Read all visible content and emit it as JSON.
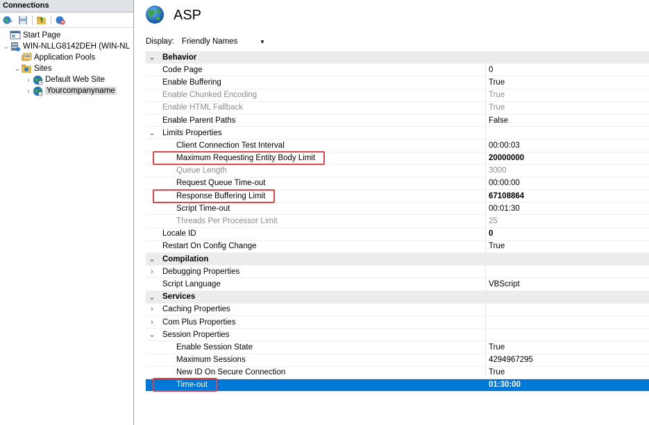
{
  "connections": {
    "header": "Connections",
    "toolbar": [
      {
        "icon": "connect-globe-icon"
      },
      {
        "icon": "save-icon"
      },
      {
        "icon": "up-folder-icon"
      },
      {
        "icon": "disconnect-icon"
      }
    ],
    "tree": [
      {
        "label": "Start Page",
        "icon": "start-page-icon",
        "level": 0,
        "expander": ""
      },
      {
        "label": "WIN-NLLG8142DEH (WIN-NL",
        "icon": "server-icon",
        "level": 0,
        "expander": "⌄"
      },
      {
        "label": "Application Pools",
        "icon": "app-pools-icon",
        "level": 1,
        "expander": ""
      },
      {
        "label": "Sites",
        "icon": "sites-folder-icon",
        "level": 1,
        "expander": "⌄"
      },
      {
        "label": "Default Web Site",
        "icon": "globe-icon",
        "level": 2,
        "expander": "›"
      },
      {
        "label": "Yourcompanyname",
        "icon": "globe-icon",
        "level": 2,
        "expander": "›",
        "selected": true
      }
    ]
  },
  "page": {
    "title": "ASP",
    "display_label": "Display:",
    "display_value": "Friendly Names"
  },
  "properties": [
    {
      "type": "category",
      "toggle": "⌄",
      "name": "Behavior",
      "value": ""
    },
    {
      "type": "prop",
      "level": 1,
      "name": "Code Page",
      "value": "0"
    },
    {
      "type": "prop",
      "level": 1,
      "name": "Enable Buffering",
      "value": "True"
    },
    {
      "type": "prop",
      "level": 1,
      "name": "Enable Chunked Encoding",
      "value": "True",
      "disabled": true
    },
    {
      "type": "prop",
      "level": 1,
      "name": "Enable HTML Fallback",
      "value": "True",
      "disabled": true
    },
    {
      "type": "prop",
      "level": 1,
      "name": "Enable Parent Paths",
      "value": "False"
    },
    {
      "type": "group",
      "toggle": "⌄",
      "level": 1,
      "name": "Limits Properties",
      "value": ""
    },
    {
      "type": "prop",
      "level": 2,
      "name": "Client Connection Test Interval",
      "value": "00:00:03"
    },
    {
      "type": "prop",
      "level": 2,
      "name": "Maximum Requesting Entity Body Limit",
      "value": "20000000",
      "bold": true,
      "highlight": true
    },
    {
      "type": "prop",
      "level": 2,
      "name": "Queue Length",
      "value": "3000",
      "disabled": true
    },
    {
      "type": "prop",
      "level": 2,
      "name": "Request Queue Time-out",
      "value": "00:00:00"
    },
    {
      "type": "prop",
      "level": 2,
      "name": "Response Buffering Limit",
      "value": "67108864",
      "bold": true,
      "highlight": true
    },
    {
      "type": "prop",
      "level": 2,
      "name": "Script Time-out",
      "value": "00:01:30"
    },
    {
      "type": "prop",
      "level": 2,
      "name": "Threads Per Processor Limit",
      "value": "25",
      "disabled": true
    },
    {
      "type": "prop",
      "level": 1,
      "name": "Locale ID",
      "value": "0",
      "bold": true
    },
    {
      "type": "prop",
      "level": 1,
      "name": "Restart On Config Change",
      "value": "True"
    },
    {
      "type": "category",
      "toggle": "⌄",
      "name": "Compilation",
      "value": ""
    },
    {
      "type": "group",
      "toggle": "›",
      "level": 1,
      "name": "Debugging Properties",
      "value": ""
    },
    {
      "type": "prop",
      "level": 1,
      "name": "Script Language",
      "value": "VBScript"
    },
    {
      "type": "category",
      "toggle": "⌄",
      "name": "Services",
      "value": ""
    },
    {
      "type": "group",
      "toggle": "›",
      "level": 1,
      "name": "Caching Properties",
      "value": ""
    },
    {
      "type": "group",
      "toggle": "›",
      "level": 1,
      "name": "Com Plus Properties",
      "value": ""
    },
    {
      "type": "group",
      "toggle": "⌄",
      "level": 1,
      "name": "Session Properties",
      "value": ""
    },
    {
      "type": "prop",
      "level": 2,
      "name": "Enable Session State",
      "value": "True"
    },
    {
      "type": "prop",
      "level": 2,
      "name": "Maximum Sessions",
      "value": "4294967295"
    },
    {
      "type": "prop",
      "level": 2,
      "name": "New ID On Secure Connection",
      "value": "True"
    },
    {
      "type": "prop",
      "level": 2,
      "name": "Time-out",
      "value": "01:30:00",
      "selected": true,
      "highlight": true
    }
  ]
}
